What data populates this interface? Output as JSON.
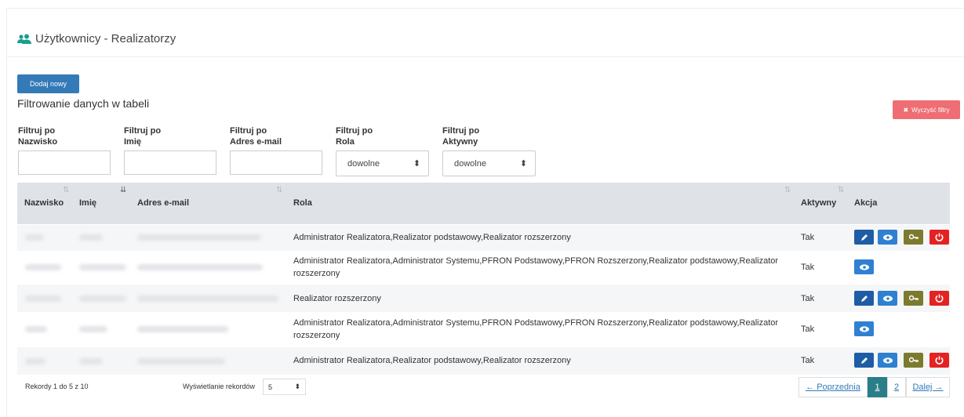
{
  "page": {
    "title": "Użytkownicy - Realizatorzy"
  },
  "toolbar": {
    "add_label": "Dodaj nowy",
    "clear_label": "Wyczyść filtry"
  },
  "filters": {
    "heading": "Filtrowanie danych w tabeli",
    "fields": [
      {
        "line1": "Filtruj po",
        "line2": "Nazwisko",
        "value": ""
      },
      {
        "line1": "Filtruj po",
        "line2": "Imię",
        "value": ""
      },
      {
        "line1": "Filtruj po",
        "line2": "Adres e-mail",
        "value": ""
      },
      {
        "line1": "Filtruj po",
        "line2": "Rola",
        "value": "dowolne"
      },
      {
        "line1": "Filtruj po",
        "line2": "Aktywny",
        "value": "dowolne"
      }
    ]
  },
  "table": {
    "columns": [
      "Nazwisko",
      "Imię",
      "Adres e-mail",
      "Rola",
      "Aktywny",
      "Akcja"
    ],
    "rows": [
      {
        "role": "Administrator Realizatora,Realizator podstawowy,Realizator rozszerzony",
        "active": "Tak"
      },
      {
        "role": "Administrator Realizatora,Administrator Systemu,PFRON Podstawowy,PFRON Rozszerzony,Realizator podstawowy,Realizator rozszerzony",
        "active": "Tak"
      },
      {
        "role": "Realizator rozszerzony",
        "active": "Tak"
      },
      {
        "role": "Administrator Realizatora,Administrator Systemu,PFRON Podstawowy,PFRON Rozszerzony,Realizator podstawowy,Realizator rozszerzony",
        "active": "Tak"
      },
      {
        "role": "Administrator Realizatora,Realizator podstawowy,Realizator rozszerzony",
        "active": "Tak"
      }
    ]
  },
  "footer": {
    "records_info": "Rekordy 1 do 5 z 10",
    "page_size_label": "Wyświetlanie rekordów",
    "page_size": "5",
    "prev_label": "← Poprzednia",
    "pages": [
      "1",
      "2"
    ],
    "next_label": "Dalej →"
  },
  "colors": {
    "primary": "#337ab7",
    "danger": "#ee6e73",
    "current_page": "#2a7e8a"
  }
}
